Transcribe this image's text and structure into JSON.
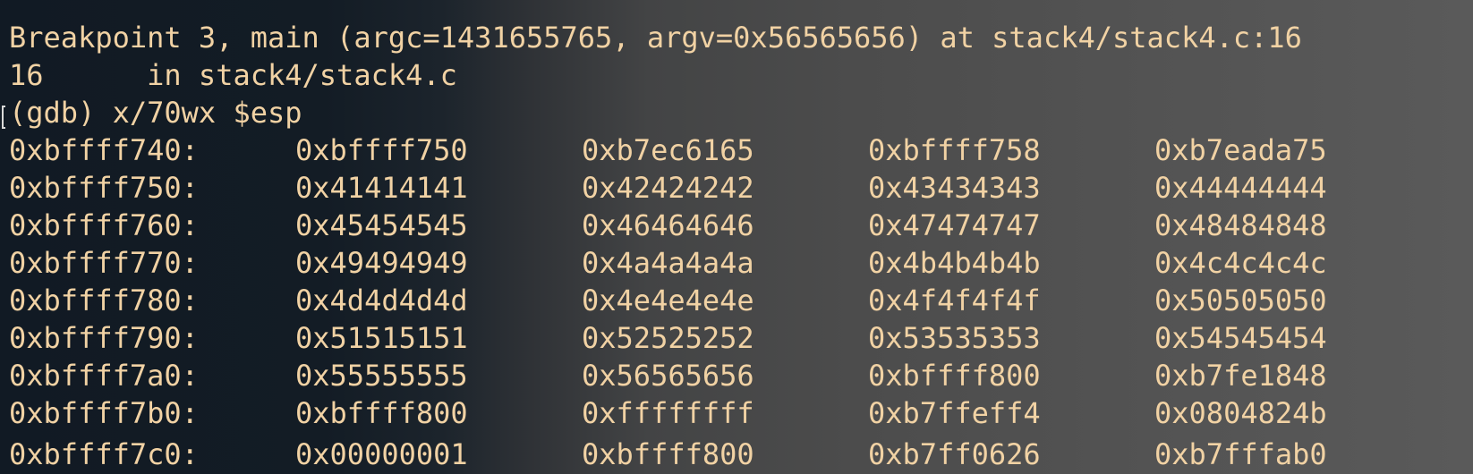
{
  "terminal": {
    "text_color": "#f1d2a4",
    "line1": "Breakpoint 3, main (argc=1431655765, argv=0x56565656) at stack4/stack4.c:16",
    "line2": "16      in stack4/stack4.c",
    "prompt": "(gdb) x/70wx $esp",
    "rows": [
      {
        "addr": "0xbffff740:",
        "w": [
          "0xbffff750",
          "0xb7ec6165",
          "0xbffff758",
          "0xb7eada75"
        ]
      },
      {
        "addr": "0xbffff750:",
        "w": [
          "0x41414141",
          "0x42424242",
          "0x43434343",
          "0x44444444"
        ]
      },
      {
        "addr": "0xbffff760:",
        "w": [
          "0x45454545",
          "0x46464646",
          "0x47474747",
          "0x48484848"
        ]
      },
      {
        "addr": "0xbffff770:",
        "w": [
          "0x49494949",
          "0x4a4a4a4a",
          "0x4b4b4b4b",
          "0x4c4c4c4c"
        ]
      },
      {
        "addr": "0xbffff780:",
        "w": [
          "0x4d4d4d4d",
          "0x4e4e4e4e",
          "0x4f4f4f4f",
          "0x50505050"
        ]
      },
      {
        "addr": "0xbffff790:",
        "w": [
          "0x51515151",
          "0x52525252",
          "0x53535353",
          "0x54545454"
        ]
      },
      {
        "addr": "0xbffff7a0:",
        "w": [
          "0x55555555",
          "0x56565656",
          "0xbffff800",
          "0xb7fe1848"
        ]
      },
      {
        "addr": "0xbffff7b0:",
        "w": [
          "0xbffff800",
          "0xffffffff",
          "0xb7ffeff4",
          "0x0804824b"
        ]
      },
      {
        "addr": "0xbffff7c0:",
        "w": [
          "0x00000001",
          "0xbffff800",
          "0xb7ff0626",
          "0xb7fffab0"
        ]
      }
    ]
  }
}
